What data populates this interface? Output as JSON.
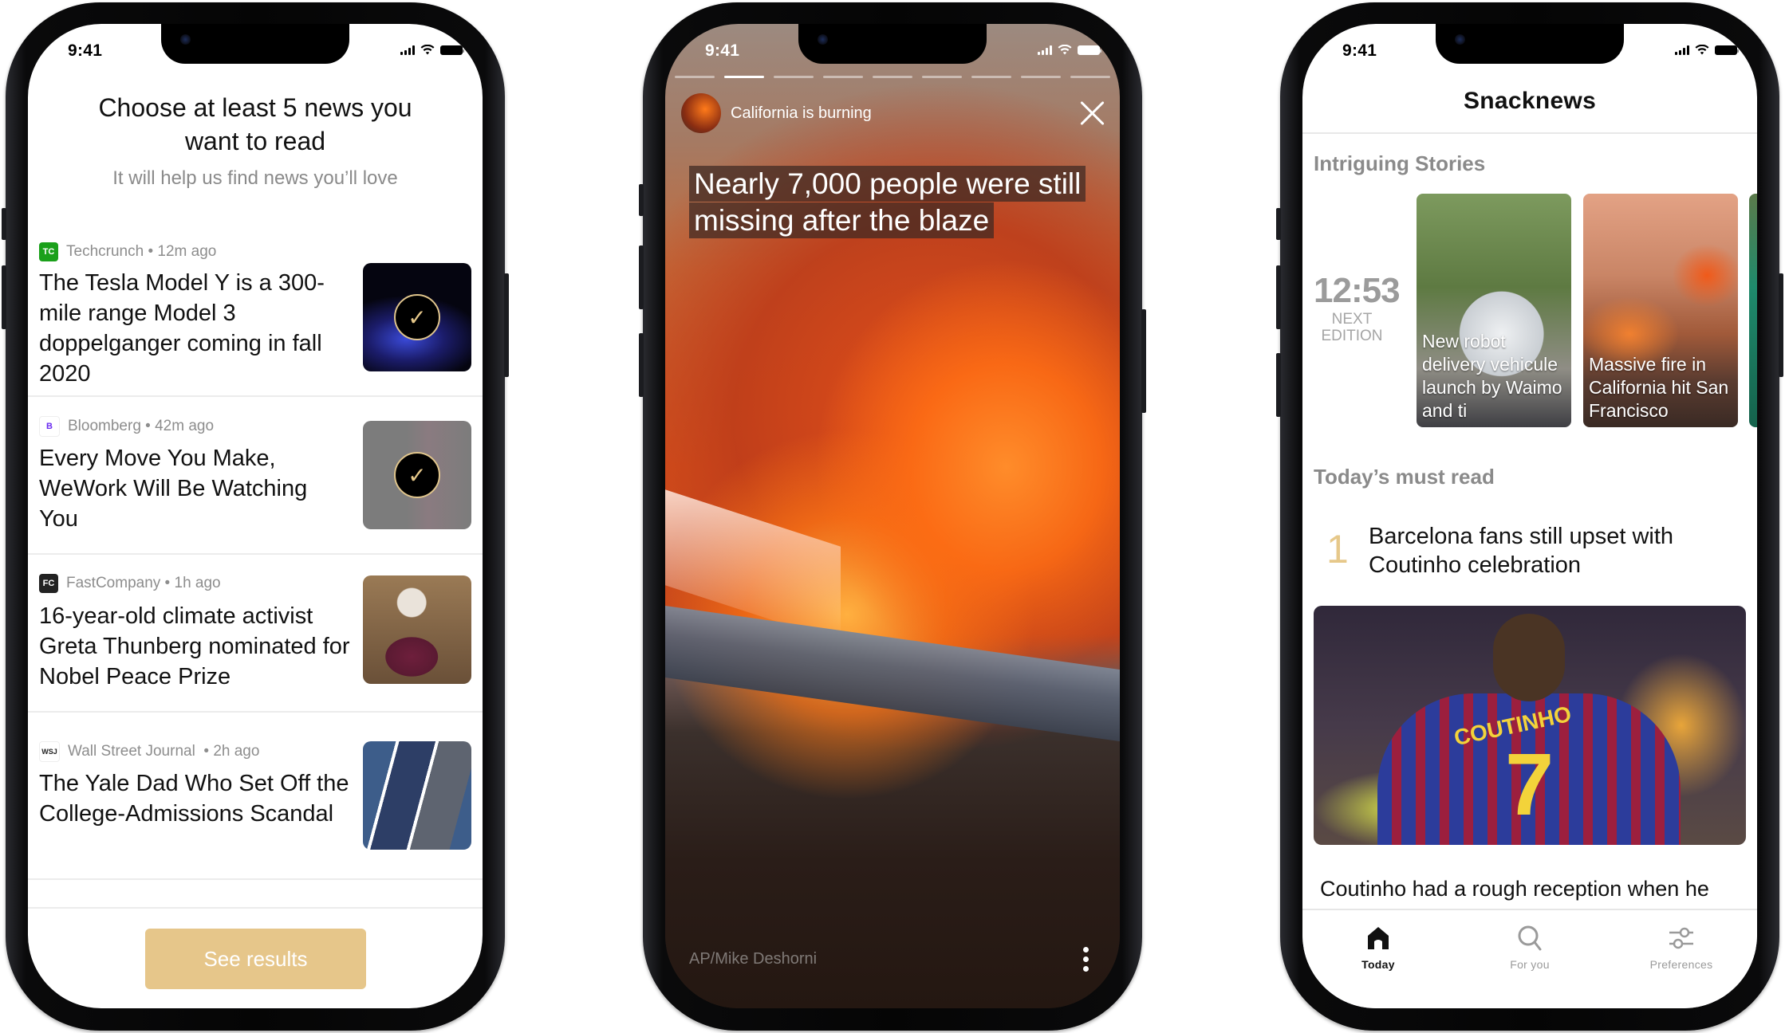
{
  "status_bar": {
    "time": "9:41"
  },
  "onboarding": {
    "title": "Choose at least 5 news you want to read",
    "subtitle": "It will help us find news you’ll love",
    "articles": [
      {
        "source_logo": "TC",
        "logo_color": "#1aa01a",
        "source": "Techcrunch",
        "age": "12m ago",
        "headline": "The Tesla Model Y is a 300-mile range Model 3 doppelganger coming in fall 2020",
        "selected": true
      },
      {
        "source_logo": "B",
        "logo_color": "#6b2cf0",
        "source": "Bloomberg",
        "age": "42m ago",
        "headline": "Every Move You Make, WeWork Will Be Watching You",
        "selected": true
      },
      {
        "source_logo": "FC",
        "logo_color": "#222222",
        "source": "FastCompany",
        "age": "1h ago",
        "headline": "16-year-old climate activist Greta Thunberg nominated for Nobel Peace Prize",
        "selected": false
      },
      {
        "source_logo": "WSJ",
        "logo_color": "#ffffff",
        "source": "Wall Street Journal",
        "age": "2h ago",
        "headline": "The Yale Dad Who Set Off the College-Admissions Scandal",
        "selected": false
      }
    ],
    "check_glyph": "✓",
    "cta_label": "See results",
    "accent_color": "#e6c68a"
  },
  "story": {
    "segments_total": 9,
    "segment_active": 2,
    "title": "California is burning",
    "headline_lines": [
      "Nearly 7,000 people were still",
      "missing after the blaze"
    ],
    "credit": "AP/Mike Deshorni"
  },
  "home": {
    "brand": "Snacknews",
    "intriguing_label": "Intriguing Stories",
    "next_edition_time": "12:53",
    "next_edition_label": [
      "NEXT",
      "EDITION"
    ],
    "stories": [
      {
        "text": "New robot delivery vehicule launch by Waimo and ti"
      },
      {
        "text": "Massive fire in California hit San Francisco"
      }
    ],
    "must_read_label": "Today’s must read",
    "must_read": {
      "rank": "1",
      "headline": "Barcelona fans still upset with Coutinho celebration",
      "jersey_name": "COUTINHO",
      "jersey_number": "7",
      "snippet": "Coutinho had a rough reception when he"
    },
    "tabs": [
      {
        "label": "Today",
        "icon": "home-icon",
        "active": true
      },
      {
        "label": "For you",
        "icon": "search-icon",
        "active": false
      },
      {
        "label": "Preferences",
        "icon": "sliders-icon",
        "active": false
      }
    ]
  }
}
